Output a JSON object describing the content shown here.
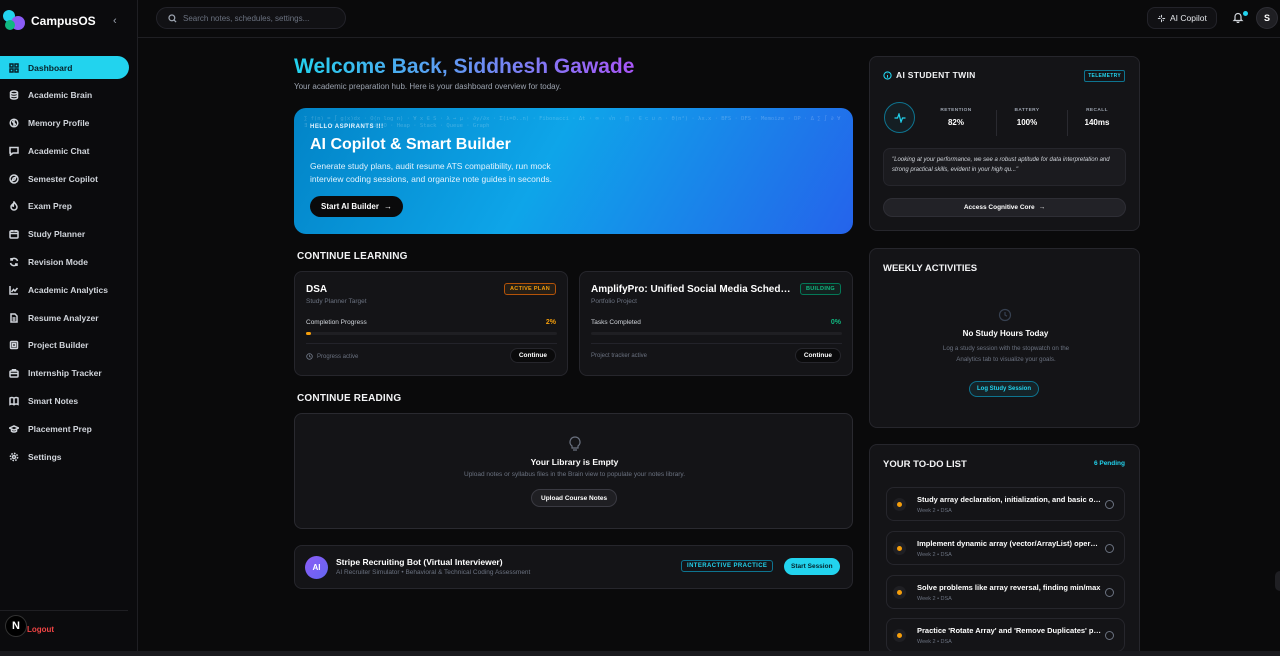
{
  "app": {
    "name": "CampusOS"
  },
  "sidebar": {
    "items": [
      {
        "label": "Dashboard",
        "icon": "grid-icon",
        "active": true
      },
      {
        "label": "Academic Brain",
        "icon": "database-icon"
      },
      {
        "label": "Memory Profile",
        "icon": "brain-icon"
      },
      {
        "label": "Academic Chat",
        "icon": "chat-icon"
      },
      {
        "label": "Semester Copilot",
        "icon": "compass-icon"
      },
      {
        "label": "Exam Prep",
        "icon": "flame-icon"
      },
      {
        "label": "Study Planner",
        "icon": "calendar-icon"
      },
      {
        "label": "Revision Mode",
        "icon": "refresh-icon"
      },
      {
        "label": "Academic Analytics",
        "icon": "chart-icon"
      },
      {
        "label": "Resume Analyzer",
        "icon": "document-icon"
      },
      {
        "label": "Project Builder",
        "icon": "cube-icon"
      },
      {
        "label": "Internship Tracker",
        "icon": "briefcase-icon"
      },
      {
        "label": "Smart Notes",
        "icon": "book-icon"
      },
      {
        "label": "Placement Prep",
        "icon": "graduation-cap-icon"
      },
      {
        "label": "Settings",
        "icon": "gear-icon"
      }
    ],
    "avatar_letter": "N",
    "logout_label": "Logout"
  },
  "topbar": {
    "search_placeholder": "Search notes, schedules, settings...",
    "copilot_label": "AI Copilot",
    "user_initial": "S"
  },
  "welcome": {
    "title": "Welcome Back, Siddhesh Gawade",
    "subtitle": "Your academic preparation hub. Here is your dashboard overview for today."
  },
  "hero": {
    "tag": "HELLO ASPIRANTS !!!",
    "title": "AI Copilot & Smart Builder",
    "description": "Generate study plans, audit resume ATS compatibility, run mock interview coding sessions, and organize note guides in seconds.",
    "button": "Start AI Builder"
  },
  "continue_learning": {
    "title": "CONTINUE LEARNING",
    "cards": [
      {
        "title": "DSA",
        "subtitle": "Study Planner Target",
        "badge": "ACTIVE PLAN",
        "progress_label": "Completion Progress",
        "progress_text": "2%",
        "progress": 0.02,
        "footer": "Progress active",
        "button": "Continue"
      },
      {
        "title": "AmplifyPro: Unified Social Media Scheduling Platform",
        "subtitle": "Portfolio Project",
        "badge": "BUILDING",
        "progress_label": "Tasks Completed",
        "progress_text": "0%",
        "progress": 0,
        "footer": "Project tracker active",
        "button": "Continue"
      }
    ]
  },
  "continue_reading": {
    "title": "CONTINUE READING",
    "empty_title": "Your Library is Empty",
    "empty_desc": "Upload notes or syllabus files in the Brain view to populate your notes library.",
    "button": "Upload Course Notes"
  },
  "interview": {
    "avatar": "AI",
    "title": "Stripe Recruiting Bot (Virtual Interviewer)",
    "subtitle": "AI Recruiter Simulator • Behavioral & Technical Coding Assessment",
    "badge": "INTERACTIVE PRACTICE",
    "button": "Start Session"
  },
  "twin": {
    "title": "AI STUDENT TWIN",
    "badge": "TELEMETRY",
    "stats": [
      {
        "label": "RETENTION",
        "value": "82%"
      },
      {
        "label": "BATTERY",
        "value": "100%"
      },
      {
        "label": "RECALL",
        "value": "140ms"
      }
    ],
    "quote": "\"Looking at your performance, we see a robust aptitude for data interpretation and strong practical skills, evident in your high qu...\"",
    "button": "Access Cognitive Core"
  },
  "weekly": {
    "title": "WEEKLY ACTIVITIES",
    "empty_title": "No Study Hours Today",
    "empty_desc": "Log a study session with the stopwatch on the Analytics tab to visualize your goals.",
    "button": "Log Study Session"
  },
  "todo": {
    "title": "YOUR TO-DO LIST",
    "count": "6 Pending",
    "items": [
      {
        "text": "Study array declaration, initialization, and basic operations",
        "meta": "Week 2 • DSA"
      },
      {
        "text": "Implement dynamic array (vector/ArrayList) operations",
        "meta": "Week 2 • DSA"
      },
      {
        "text": "Solve problems like array reversal, finding min/max",
        "meta": "Week 2 • DSA"
      },
      {
        "text": "Practice 'Rotate Array' and 'Remove Duplicates' problems",
        "meta": "Week 2 • DSA"
      }
    ]
  },
  "colors": {
    "accent": "#22d3ee",
    "warning": "#f59e0b",
    "success": "#10b981",
    "danger": "#ef4444"
  }
}
